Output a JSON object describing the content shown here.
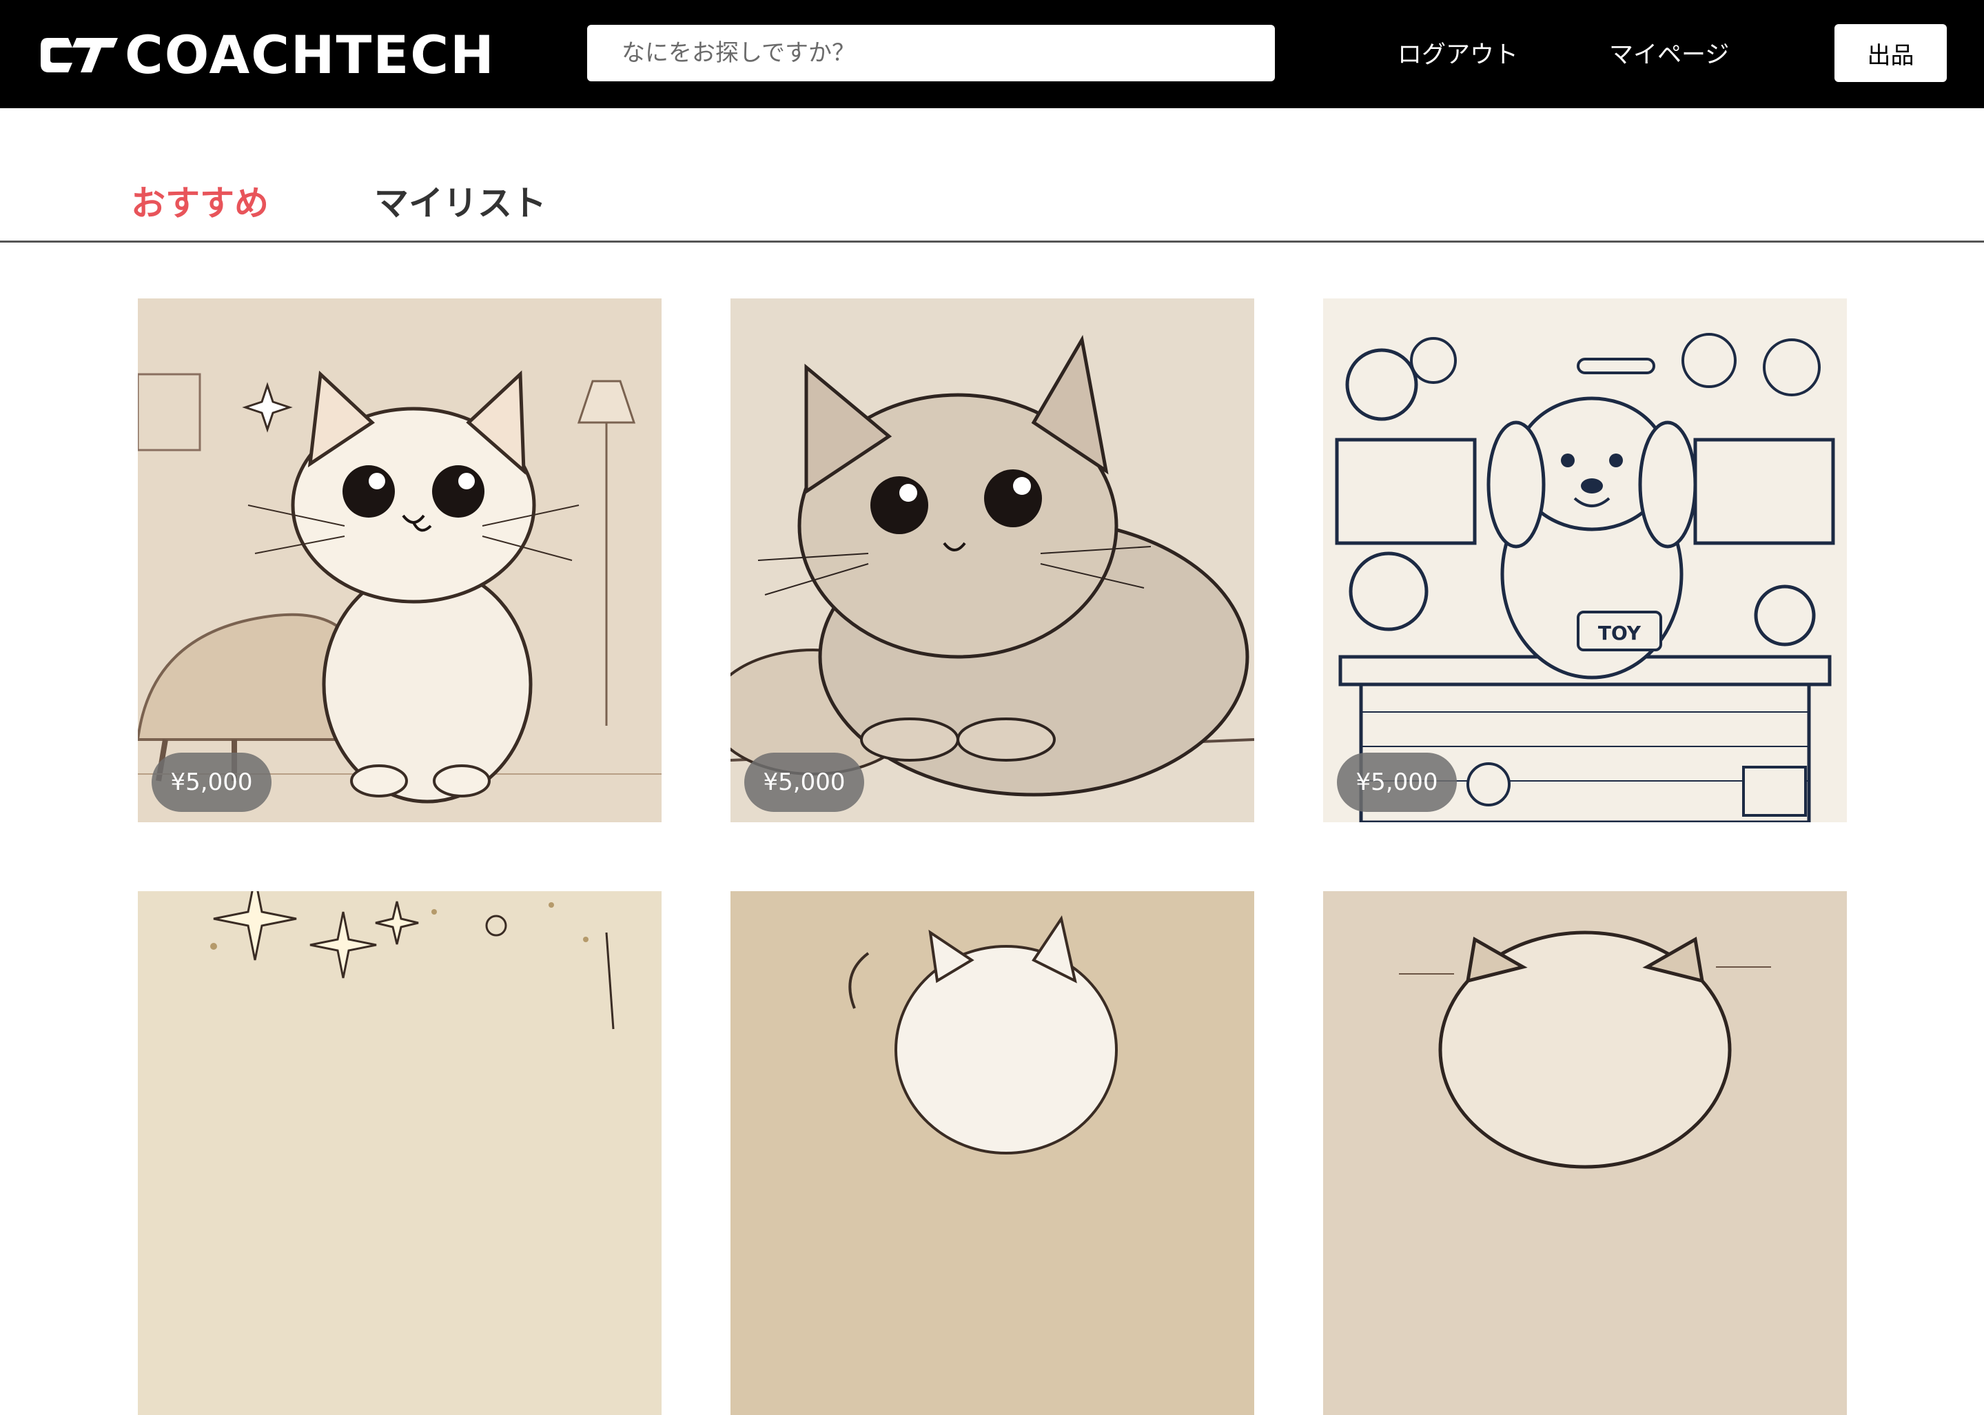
{
  "header": {
    "logo_text": "COACHTECH",
    "search": {
      "placeholder": "なにをお探しですか？",
      "value": ""
    },
    "nav": {
      "logout": "ログアウト",
      "mypage": "マイページ"
    },
    "sell_label": "出品"
  },
  "tabs": [
    {
      "label": "おすすめ",
      "active": true
    },
    {
      "label": "マイリスト",
      "active": false
    }
  ],
  "colors": {
    "header_bg": "#000000",
    "accent": "#e8545a",
    "price_badge": "#7a7a7a"
  },
  "products": [
    {
      "price": "¥5,000",
      "image": "cat-sitting-in-living-room"
    },
    {
      "price": "¥5,000",
      "image": "cat-lying-down"
    },
    {
      "price": "¥5,000",
      "image": "dog-toy-shop"
    },
    {
      "image": "sparkles-background"
    },
    {
      "image": "white-kitten"
    },
    {
      "image": "cat-face"
    }
  ]
}
